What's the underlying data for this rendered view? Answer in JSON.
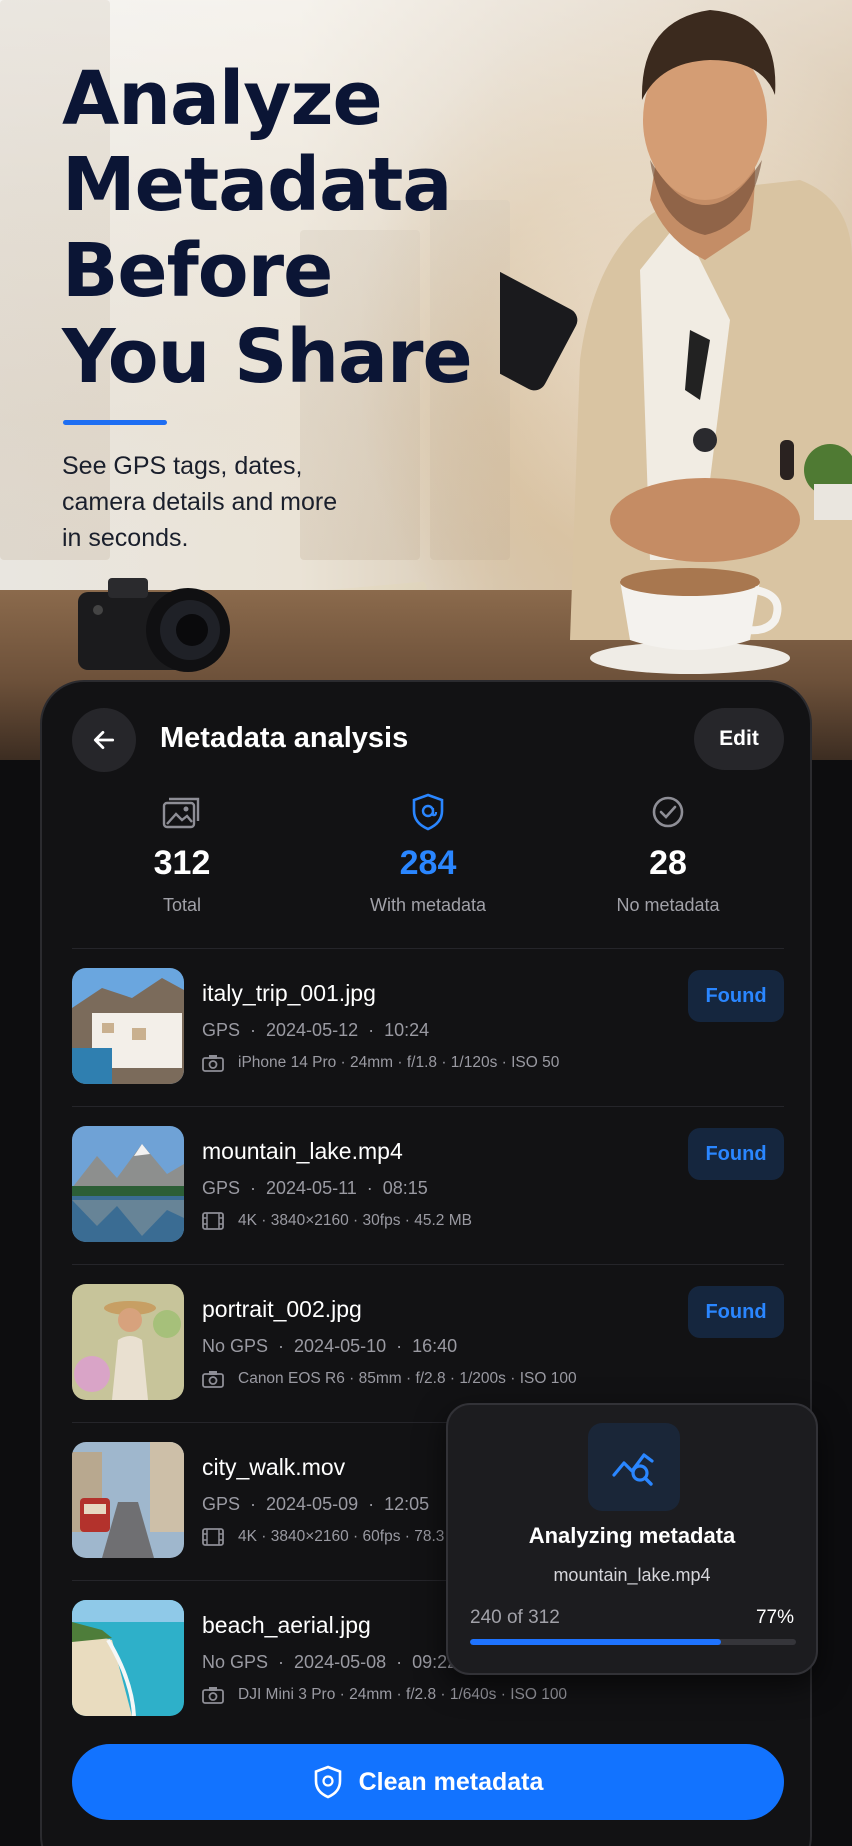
{
  "hero": {
    "title_lines": [
      "Analyze",
      "Metadata",
      "Before",
      "You Share"
    ],
    "subtitle": "See GPS tags, dates, camera details and more in seconds."
  },
  "header": {
    "title": "Metadata analysis",
    "edit_label": "Edit"
  },
  "stats": [
    {
      "value": "312",
      "label": "Total",
      "icon": "photos-icon"
    },
    {
      "value": "284",
      "label": "With metadata",
      "icon": "shield-icon"
    },
    {
      "value": "28",
      "label": "No metadata",
      "icon": "check-circle-icon"
    }
  ],
  "files": [
    {
      "name": "italy_trip_001.jpg",
      "gps": "GPS",
      "date": "2024-05-12",
      "time": "10:24",
      "device_icon": "camera-icon",
      "details": "iPhone 14 Pro · 24mm · f/1.8 · 1/120s · ISO 50",
      "status": "Found"
    },
    {
      "name": "mountain_lake.mp4",
      "gps": "GPS",
      "date": "2024-05-11",
      "time": "08:15",
      "device_icon": "film-icon",
      "details": "4K · 3840×2160 · 30fps · 45.2 MB",
      "status": "Found"
    },
    {
      "name": "portrait_002.jpg",
      "gps": "No GPS",
      "date": "2024-05-10",
      "time": "16:40",
      "device_icon": "camera-icon",
      "details": "Canon EOS R6 · 85mm · f/2.8 · 1/200s · ISO 100",
      "status": "Found"
    },
    {
      "name": "city_walk.mov",
      "gps": "GPS",
      "date": "2024-05-09",
      "time": "12:05",
      "device_icon": "film-icon",
      "details": "4K · 3840×2160 · 60fps · 78.3 M",
      "status": ""
    },
    {
      "name": "beach_aerial.jpg",
      "gps": "No GPS",
      "date": "2024-05-08",
      "time": "09:22",
      "device_icon": "camera-icon",
      "details": "DJI Mini 3 Pro · 24mm · f/2.8 · 1/640s · ISO 100",
      "status": ""
    }
  ],
  "clean_button": "Clean metadata",
  "popup": {
    "title": "Analyzing metadata",
    "file": "mountain_lake.mp4",
    "count": "240 of 312",
    "percent": "77%",
    "progress": 0.77
  },
  "colors": {
    "accent": "#1273ff",
    "accent_text": "#2a86ff",
    "hero_title": "#0b1535"
  }
}
